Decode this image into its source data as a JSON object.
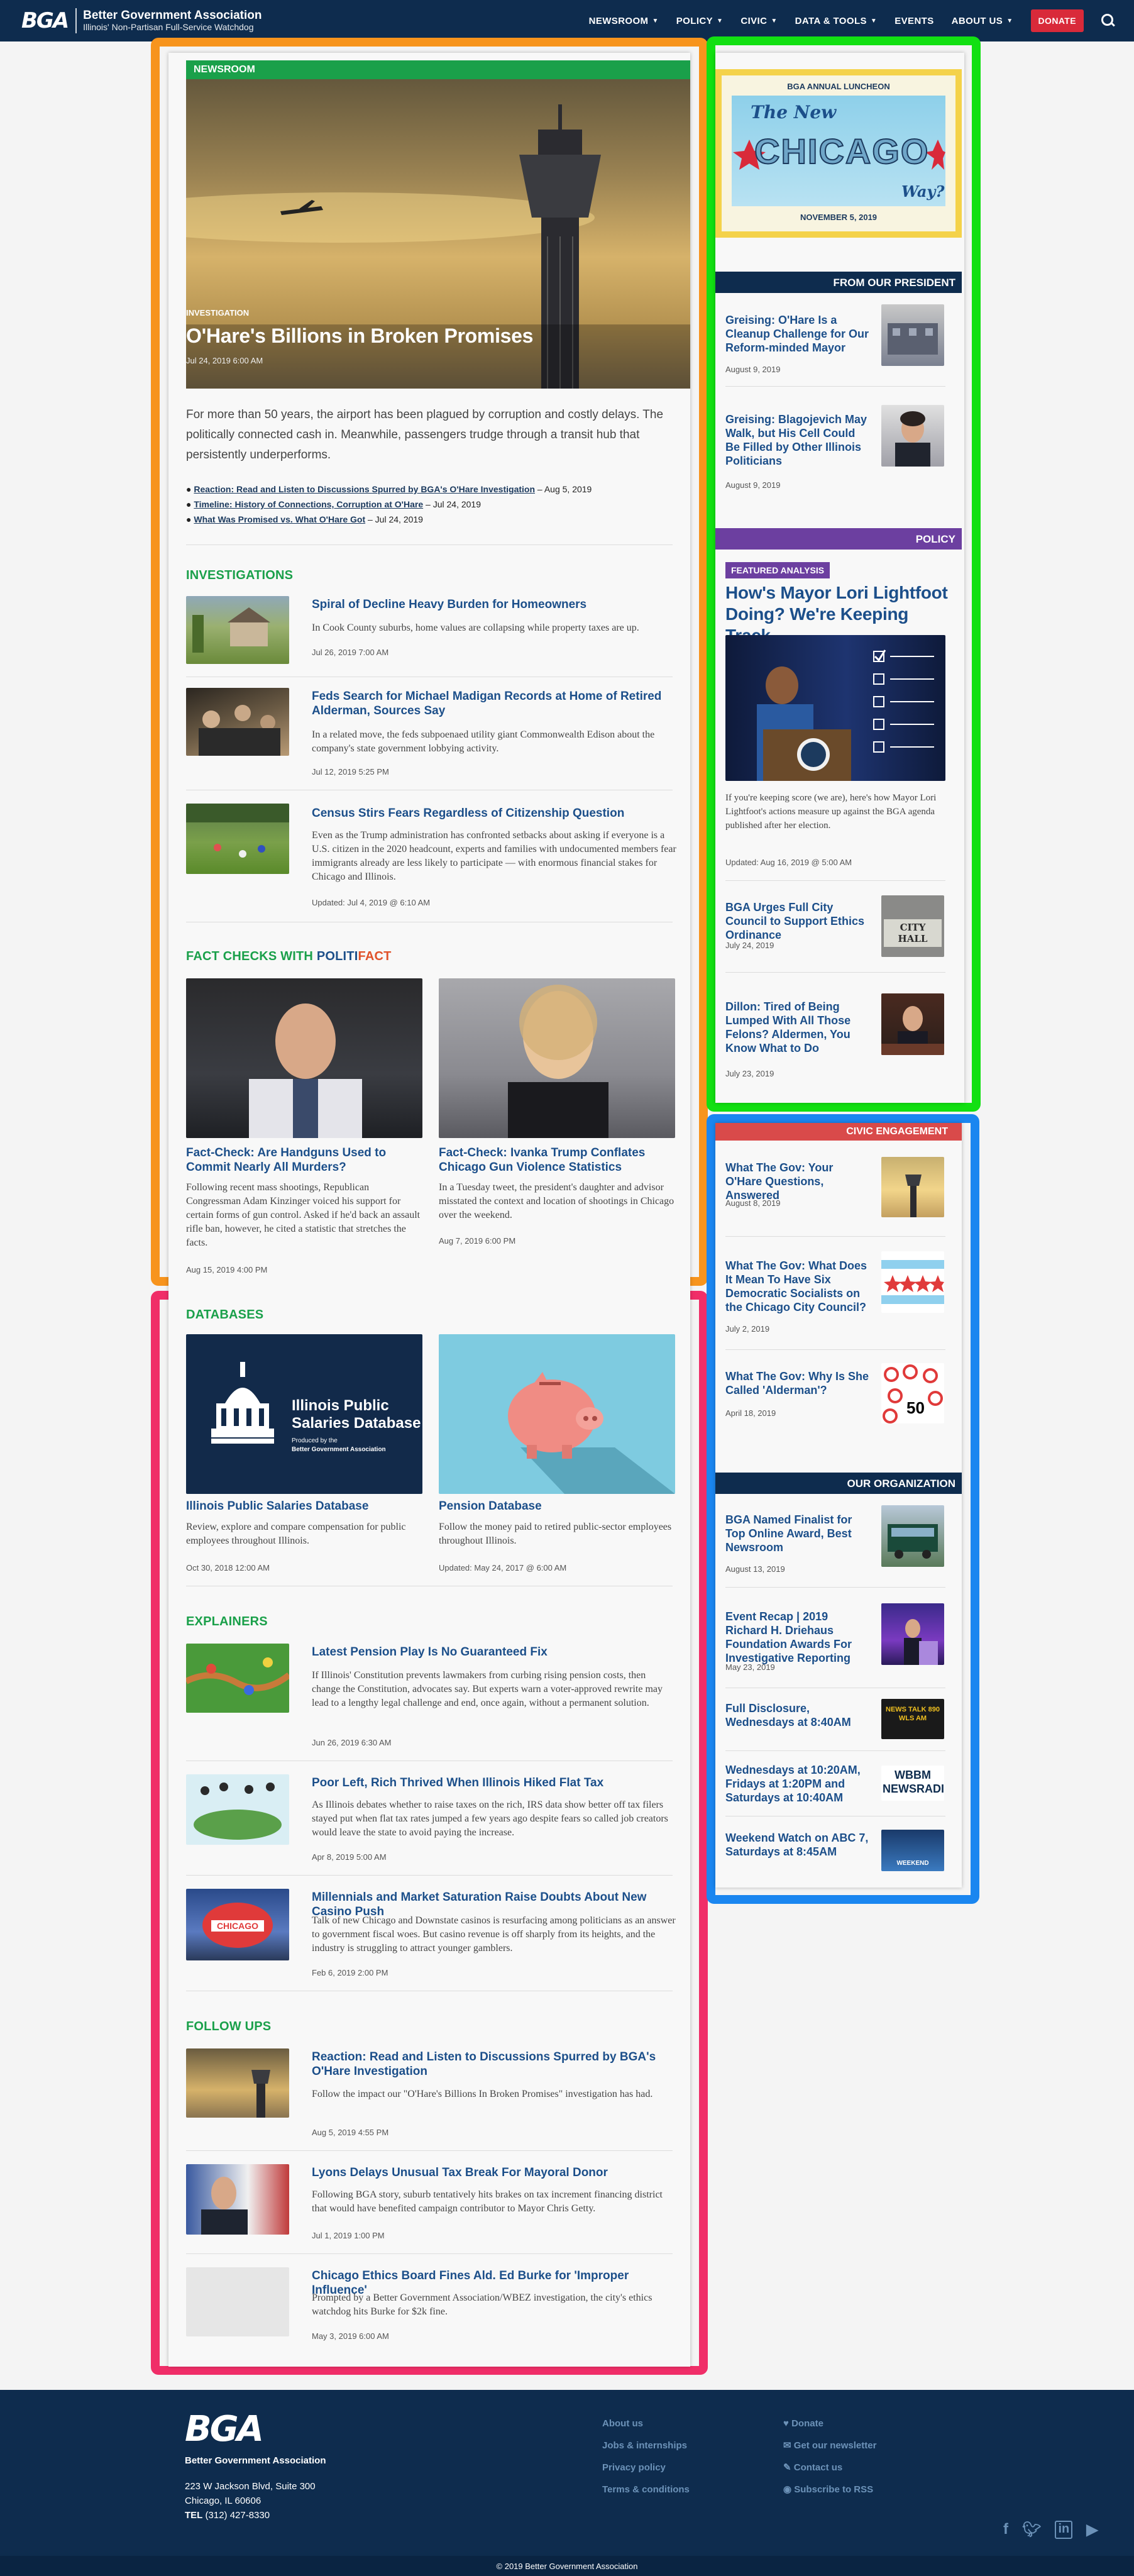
{
  "header": {
    "logo": "BGA",
    "org_name": "Better Government Association",
    "tagline": "Illinois' Non-Partisan Full-Service Watchdog",
    "nav": [
      {
        "label": "NEWSROOM"
      },
      {
        "label": "POLICY"
      },
      {
        "label": "CIVIC"
      },
      {
        "label": "DATA & TOOLS"
      },
      {
        "label": "EVENTS"
      },
      {
        "label": "ABOUT US"
      }
    ],
    "donate": "DONATE"
  },
  "hero": {
    "section_badge": "NEWSROOM",
    "kicker": "INVESTIGATION",
    "title": "O'Hare's Billions in Broken Promises",
    "date": "Jul 24, 2019 6:00 AM",
    "summary": "For more than 50 years, the airport has been plagued by corruption and costly delays. The politically connected cash in. Meanwhile, passengers trudge through a transit hub that persistently underperforms.",
    "links": [
      {
        "text": "Reaction: Read and Listen to Discussions Spurred by BGA's O'Hare Investigation",
        "date": " – Aug 5, 2019"
      },
      {
        "text": "Timeline: History of Connections, Corruption at O'Hare",
        "date": " – Jul 24, 2019"
      },
      {
        "text": "What Was Promised vs. What O'Hare Got",
        "date": " – Jul 24, 2019"
      }
    ]
  },
  "investigations": {
    "heading": "INVESTIGATIONS",
    "items": [
      {
        "title": "Spiral of Decline Heavy Burden for Homeowners",
        "excerpt": "In Cook County suburbs, home values are collapsing while property taxes are up.",
        "date": "Jul 26, 2019 7:00 AM"
      },
      {
        "title": "Feds Search for Michael Madigan Records at Home of Retired Alderman, Sources Say",
        "excerpt": "In a related move, the feds subpoenaed utility giant Commonwealth Edison about the company's state government lobbying activity.",
        "date": "Jul 12, 2019 5:25 PM"
      },
      {
        "title": "Census Stirs Fears Regardless of Citizenship Question",
        "excerpt": "Even as the Trump administration has confronted setbacks about asking if everyone is a U.S. citizen in the 2020 headcount, experts and families with undocumented members fear immigrants already are less likely to participate — with enormous financial stakes for Chicago and Illinois.",
        "date": "Updated: Jul 4, 2019 @ 6:10 AM"
      }
    ]
  },
  "factchecks": {
    "heading_pre": "FACT CHECKS WITH ",
    "brand_a": "POLITI",
    "brand_b": "FACT",
    "items": [
      {
        "title": "Fact-Check: Are Handguns Used to Commit Nearly All Murders?",
        "excerpt": "Following recent mass shootings, Republican Congressman Adam Kinzinger voiced his support for certain forms of gun control. Asked if he'd back an assault rifle ban, however, he cited a statistic that stretches the facts.",
        "date": "Aug 15, 2019 4:00 PM"
      },
      {
        "title": "Fact-Check: Ivanka Trump Conflates Chicago Gun Violence Statistics",
        "excerpt": "In a Tuesday tweet, the president's daughter and advisor misstated the context and location of shootings in Chicago over the weekend.",
        "date": "Aug 7, 2019 6:00 PM"
      }
    ]
  },
  "databases": {
    "heading": "DATABASES",
    "salaries_img": {
      "line1": "Illinois Public",
      "line2": "Salaries Database",
      "line3": "Produced by the",
      "line4": "Better Government Association"
    },
    "items": [
      {
        "title": "Illinois Public Salaries Database",
        "excerpt": "Review, explore and compare compensation for public employees throughout Illinois.",
        "date": "Oct 30, 2018 12:00 AM"
      },
      {
        "title": "Pension Database",
        "excerpt": "Follow the money paid to retired public-sector employees throughout Illinois.",
        "date": "Updated: May 24, 2017 @ 6:00 AM"
      }
    ]
  },
  "explainers": {
    "heading": "EXPLAINERS",
    "items": [
      {
        "title": "Latest Pension Play Is No Guaranteed Fix",
        "excerpt": "If Illinois' Constitution prevents lawmakers from curbing rising pension costs, then change the Constitution, advocates say. But experts warn a voter-approved rewrite may lead to a lengthy legal challenge and end, once again, without a permanent solution.",
        "date": "Jun 26, 2019 6:30 AM"
      },
      {
        "title": "Poor Left, Rich Thrived When Illinois Hiked Flat Tax",
        "excerpt": "As Illinois debates whether to raise taxes on the rich, IRS data show better off tax filers stayed put when flat tax rates jumped a few years ago despite fears so called job creators would leave the state to avoid paying the increase.",
        "date": "Apr 8, 2019 5:00 AM"
      },
      {
        "title": "Millennials and Market Saturation Raise Doubts About New Casino Push",
        "excerpt": "Talk of new Chicago and Downstate casinos is resurfacing among politicians as an answer to government fiscal woes. But casino revenue is off sharply from its heights, and the industry is struggling to attract younger gamblers.",
        "date": "Feb 6, 2019 2:00 PM"
      }
    ]
  },
  "followups": {
    "heading": "FOLLOW UPS",
    "items": [
      {
        "title": "Reaction: Read and Listen to Discussions Spurred by BGA's O'Hare Investigation",
        "excerpt": "Follow the impact our \"O'Hare's Billions In Broken Promises\" investigation has had.",
        "date": "Aug 5, 2019 4:55 PM"
      },
      {
        "title": "Lyons Delays Unusual Tax Break For Mayoral Donor",
        "excerpt": "Following BGA story, suburb tentatively hits brakes on tax increment financing district that would have benefited campaign contributor to Mayor Chris Getty.",
        "date": "Jul 1, 2019 1:00 PM"
      },
      {
        "title": "Chicago Ethics Board Fines Ald. Ed Burke for 'Improper Influence'",
        "excerpt": "Prompted by a Better Government Association/WBEZ investigation, the city's ethics watchdog hits Burke for $2k fine.",
        "date": "May 3, 2019 6:00 AM"
      }
    ]
  },
  "sidebar": {
    "luncheon": {
      "top": "BGA ANNUAL LUNCHEON",
      "the_new": "The New",
      "city": "CHICAGO",
      "way": "Way?",
      "date": "NOVEMBER 5, 2019"
    },
    "president": {
      "heading": "FROM OUR PRESIDENT",
      "items": [
        {
          "title": "Greising: O'Hare Is a Cleanup Challenge for Our Reform-minded Mayor",
          "date": "August 9, 2019"
        },
        {
          "title": "Greising: Blagojevich May Walk, but His Cell Could Be Filled by Other Illinois Politicians",
          "date": "August 9, 2019"
        }
      ]
    },
    "policy": {
      "heading": "POLICY",
      "badge": "FEATURED ANALYSIS",
      "title": "How's Mayor Lori Lightfoot Doing? We're Keeping Track.",
      "excerpt": "If you're keeping score (we are), here's how Mayor Lori Lightfoot's actions measure up against the BGA agenda published after her election.",
      "date": "Updated: Aug 16, 2019 @ 5:00 AM",
      "items": [
        {
          "title": "BGA Urges Full City Council to Support Ethics Ordinance",
          "date": "July 24, 2019",
          "img_text": "CITY HALL"
        },
        {
          "title": "Dillon: Tired of Being Lumped With All Those Felons? Aldermen, You Know What to Do",
          "date": "July 23, 2019"
        }
      ]
    },
    "civic": {
      "heading": "CIVIC ENGAGEMENT",
      "items": [
        {
          "title": "What The Gov: Your O'Hare Questions, Answered",
          "date": "August 8, 2019"
        },
        {
          "title": "What The Gov: What Does It Mean To Have Six Democratic Socialists on the Chicago City Council?",
          "date": "July 2, 2019"
        },
        {
          "title": "What The Gov: Why Is She Called 'Alderman'?",
          "date": "April 18, 2019",
          "img_num": "50"
        }
      ]
    },
    "org": {
      "heading": "OUR ORGANIZATION",
      "items": [
        {
          "title": "BGA Named Finalist for Top Online Award, Best Newsroom",
          "date": "August 13, 2019"
        },
        {
          "title": "Event Recap | 2019 Richard H. Driehaus Foundation Awards For Investigative Reporting",
          "date": "May 23, 2019"
        },
        {
          "title": "Full Disclosure, Wednesdays at 8:40AM",
          "date": "",
          "img_text": "NEWS TALK 890 WLS AM"
        },
        {
          "title": "Wednesdays at 10:20AM, Fridays at 1:20PM and Saturdays at 10:40AM",
          "date": "",
          "img_text": "WBBM NEWSRADIO"
        },
        {
          "title": "Weekend Watch on ABC 7, Saturdays at 8:45AM",
          "date": "",
          "img_text": "WEEKEND"
        }
      ]
    }
  },
  "footer": {
    "logo": "BGA",
    "org_name": "Better Government Association",
    "address1": "223 W Jackson Blvd, Suite 300",
    "address2": "Chicago, IL 60606",
    "tel_label": "TEL",
    "tel": " (312) 427-8330",
    "links_a": [
      "About us",
      "Jobs & internships",
      "Privacy policy",
      "Terms & conditions"
    ],
    "links_b": [
      "Donate",
      "Get our newsletter",
      "Contact us",
      "Subscribe to RSS"
    ],
    "copyright": "© 2019 Better Government Association"
  },
  "colors": {
    "navy": "#0e2c4e",
    "green": "#1aa04a",
    "link": "#1c4f8a",
    "red": "#d92a3a",
    "purple": "#6c3fa0",
    "orange_box": "#f7941d",
    "pink_box": "#f02e68",
    "green_box": "#12e012",
    "blue_box": "#1a86f0"
  }
}
